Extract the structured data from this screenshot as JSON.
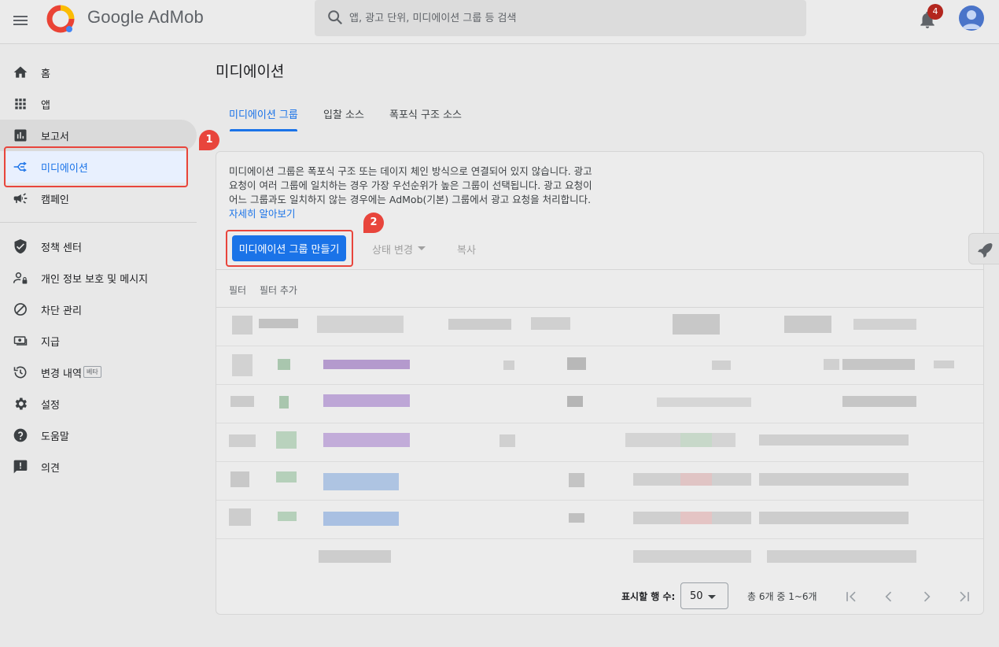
{
  "app": {
    "brand_prefix": "Google",
    "brand_name": "AdMob",
    "notification_count": "4"
  },
  "search": {
    "placeholder": "앱, 광고 단위, 미디에이션 그룹 등 검색"
  },
  "sidebar": {
    "items": [
      {
        "label": "홈",
        "icon": "home-icon"
      },
      {
        "label": "앱",
        "icon": "apps-grid-icon"
      },
      {
        "label": "보고서",
        "icon": "bar-chart-icon"
      },
      {
        "label": "미디에이션",
        "icon": "mediation-icon"
      },
      {
        "label": "캠페인",
        "icon": "megaphone-icon"
      },
      {
        "label": "정책 센터",
        "icon": "shield-icon"
      },
      {
        "label": "개인 정보 보호 및 메시지",
        "icon": "person-lock-icon"
      },
      {
        "label": "차단 관리",
        "icon": "block-icon"
      },
      {
        "label": "지급",
        "icon": "payments-icon"
      },
      {
        "label": "변경 내역",
        "icon": "history-icon",
        "badge": "베타"
      },
      {
        "label": "설정",
        "icon": "gear-icon"
      },
      {
        "label": "도움말",
        "icon": "help-icon"
      },
      {
        "label": "의견",
        "icon": "feedback-icon"
      }
    ]
  },
  "annotations": {
    "step1": "1",
    "step2": "2"
  },
  "main": {
    "title": "미디에이션",
    "tabs": [
      {
        "label": "미디에이션 그룹",
        "active": true
      },
      {
        "label": "입찰 소스",
        "active": false
      },
      {
        "label": "폭포식 구조 소스",
        "active": false
      }
    ],
    "description": "미디에이션 그룹은 폭포식 구조 또는 데이지 체인 방식으로 연결되어 있지 않습니다. 광고 요청이 여러 그룹에 일치하는 경우 가장 우선순위가 높은 그룹이 선택됩니다. 광고 요청이 어느 그룹과도 일치하지 않는 경우에는 AdMob(기본) 그룹에서 광고 요청을 처리합니다.",
    "learn_more": "자세히 알아보기",
    "toolbar": {
      "create_label": "미디에이션 그룹 만들기",
      "status_label": "상태 변경",
      "copy_label": "복사"
    },
    "filter": {
      "label": "필터",
      "add_label": "필터 추가"
    },
    "pagination": {
      "rows_label": "표시할 행 수:",
      "rows_value": "50",
      "range_text": "총 6개 중 1~6개"
    }
  },
  "colors": {
    "accent": "#1a73e8",
    "annotation_red": "#e8453c",
    "badge_red": "#b3261e"
  }
}
